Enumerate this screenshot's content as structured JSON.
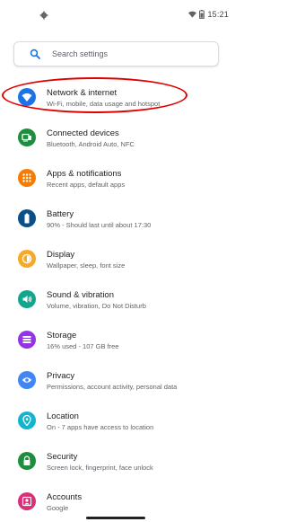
{
  "status_bar": {
    "time": "15:21",
    "icons": [
      "gear-icon",
      "wifi-icon",
      "battery-icon"
    ]
  },
  "search": {
    "placeholder": "Search settings"
  },
  "items": [
    {
      "title": "Network & internet",
      "subtitle": "Wi-Fi, mobile, data usage and hotspot",
      "icon": "wifi-icon",
      "color": "#1a73e8"
    },
    {
      "title": "Connected devices",
      "subtitle": "Bluetooth, Android Auto, NFC",
      "icon": "devices-icon",
      "color": "#1e8e3e"
    },
    {
      "title": "Apps & notifications",
      "subtitle": "Recent apps, default apps",
      "icon": "apps-icon",
      "color": "#f57c00"
    },
    {
      "title": "Battery",
      "subtitle": "90% - Should last until about 17:30",
      "icon": "battery-icon",
      "color": "#0b4f8a"
    },
    {
      "title": "Display",
      "subtitle": "Wallpaper, sleep, font size",
      "icon": "display-icon",
      "color": "#f9a825"
    },
    {
      "title": "Sound & vibration",
      "subtitle": "Volume, vibration, Do Not Disturb",
      "icon": "sound-icon",
      "color": "#12a68f"
    },
    {
      "title": "Storage",
      "subtitle": "16% used - 107 GB free",
      "icon": "storage-icon",
      "color": "#9334e6"
    },
    {
      "title": "Privacy",
      "subtitle": "Permissions, account activity, personal data",
      "icon": "privacy-icon",
      "color": "#4285f4"
    },
    {
      "title": "Location",
      "subtitle": "On - 7 apps have access to location",
      "icon": "location-icon",
      "color": "#12b5cb"
    },
    {
      "title": "Security",
      "subtitle": "Screen lock, fingerprint, face unlock",
      "icon": "lock-icon",
      "color": "#1e8e3e"
    },
    {
      "title": "Accounts",
      "subtitle": "Google",
      "icon": "accounts-icon",
      "color": "#d93077"
    }
  ],
  "highlight_color": "#e00000"
}
